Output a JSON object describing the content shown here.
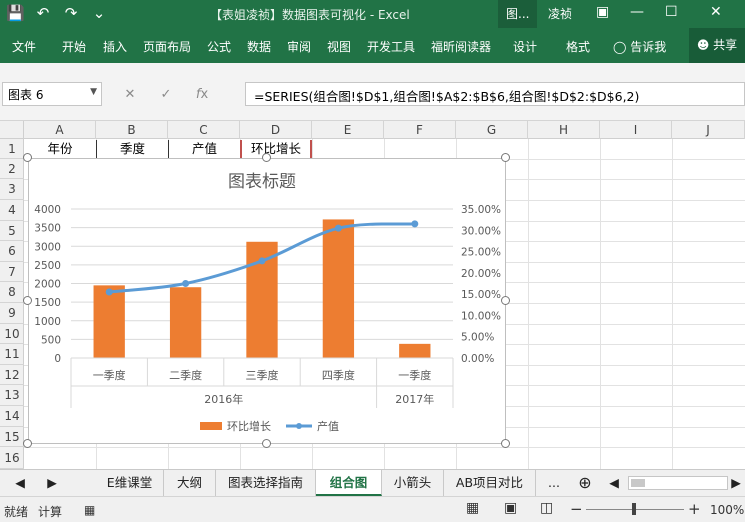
{
  "window": {
    "title": "【表姐凌祯】数据图表可视化 - Excel",
    "context_tab": "图...",
    "user": "凌祯"
  },
  "ribbon": {
    "tabs": [
      "文件",
      "开始",
      "插入",
      "页面布局",
      "公式",
      "数据",
      "审阅",
      "视图",
      "开发工具",
      "福昕阅读器",
      "设计",
      "格式"
    ],
    "tell_me": "告诉我",
    "share": "共享"
  },
  "formula_bar": {
    "name_box": "图表 6",
    "formula": "=SERIES(组合图!$D$1,组合图!$A$2:$B$6,组合图!$D$2:$D$6,2)"
  },
  "sheet": {
    "columns": [
      "A",
      "B",
      "C",
      "D",
      "E",
      "F",
      "G",
      "H",
      "I",
      "J"
    ],
    "rows": [
      "1",
      "2",
      "3",
      "4",
      "5",
      "6",
      "7",
      "8",
      "9",
      "10",
      "11",
      "12",
      "13",
      "14",
      "15",
      "16"
    ],
    "header_row": [
      "年份",
      "季度",
      "产值",
      "环比增长"
    ]
  },
  "chart_data": {
    "type": "bar",
    "title": "图表标题",
    "categories": [
      "一季度",
      "二季度",
      "三季度",
      "四季度",
      "一季度"
    ],
    "groups": [
      {
        "label": "2016年",
        "span": 4
      },
      {
        "label": "2017年",
        "span": 1
      }
    ],
    "series": [
      {
        "name": "环比增长",
        "type": "bar",
        "axis": "left",
        "color": "#ED7D31",
        "values": [
          1950,
          1900,
          3120,
          3720,
          380
        ]
      },
      {
        "name": "产值",
        "type": "line",
        "axis": "right",
        "color": "#5B9BD5",
        "values": [
          0.155,
          0.175,
          0.228,
          0.305,
          0.315
        ]
      }
    ],
    "y_left": {
      "range": [
        0,
        4000
      ],
      "ticks": [
        "0",
        "500",
        "1000",
        "1500",
        "2000",
        "2500",
        "3000",
        "3500",
        "4000"
      ]
    },
    "y_right": {
      "range": [
        0,
        0.35
      ],
      "ticks": [
        "0.00%",
        "5.00%",
        "10.00%",
        "15.00%",
        "20.00%",
        "25.00%",
        "30.00%",
        "35.00%"
      ]
    },
    "grid": true,
    "legend": "bottom"
  },
  "sheet_tabs": [
    "E维课堂",
    "大纲",
    "图表选择指南",
    "组合图",
    "小箭头",
    "AB项目对比",
    "..."
  ],
  "active_sheet": "组合图",
  "status": {
    "mode": "就绪",
    "calc": "计算",
    "zoom": "100%"
  }
}
